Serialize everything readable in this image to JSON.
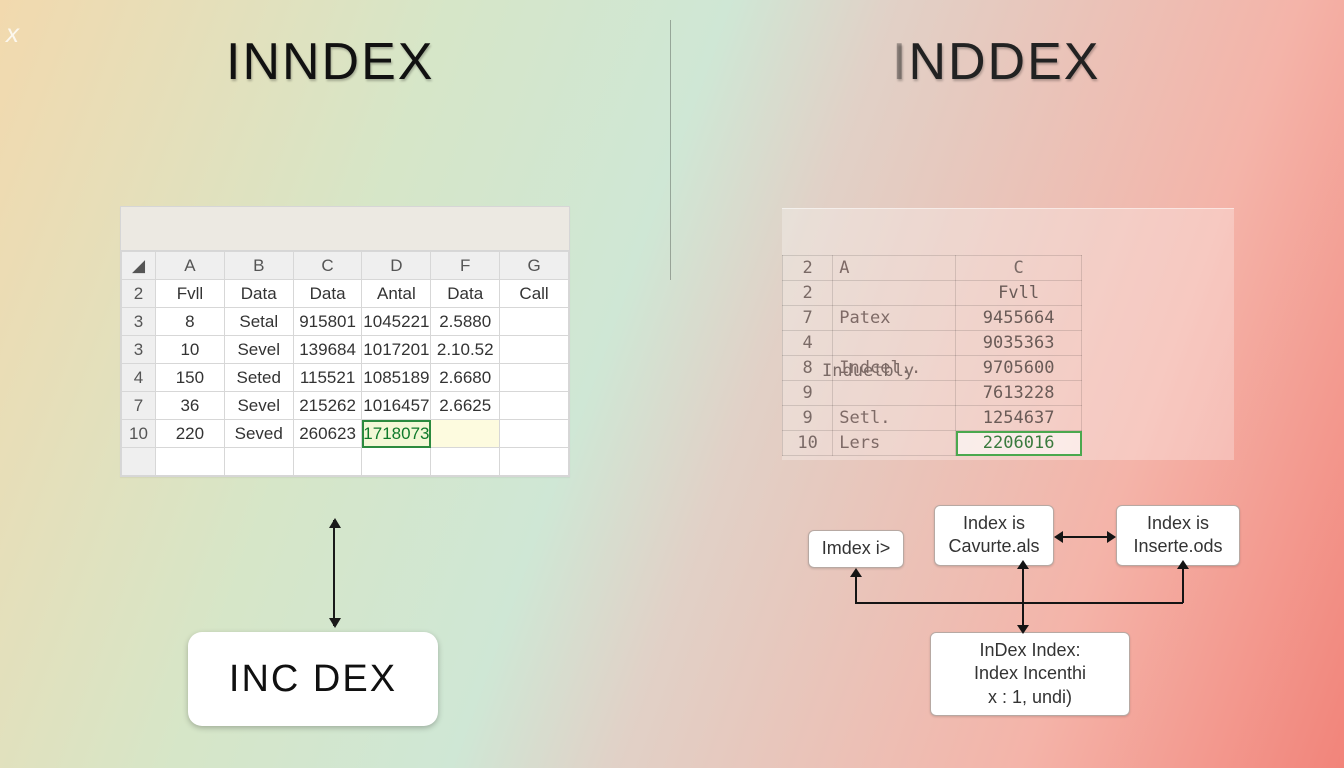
{
  "titles": {
    "left": "INNDEX",
    "right_fade": "I",
    "right_rest": "NDDEX"
  },
  "left_sheet": {
    "cols": [
      "",
      "A",
      "B",
      "C",
      "D",
      "F",
      "G"
    ],
    "rows": [
      {
        "h": "2",
        "cells": [
          "Fvll",
          "Data",
          "Data",
          "Antal",
          "Data",
          "Call"
        ]
      },
      {
        "h": "3",
        "cells": [
          "8",
          "Setal",
          "915801",
          "1045221",
          "2.5880",
          ""
        ]
      },
      {
        "h": "3",
        "cells": [
          "10",
          "Sevel",
          "139684",
          "1017201",
          "2.10.52",
          ""
        ]
      },
      {
        "h": "4",
        "cells": [
          "150",
          "Seted",
          "115521",
          "1085189",
          "2.6680",
          ""
        ]
      },
      {
        "h": "7",
        "cells": [
          "36",
          "Sevel",
          "215262",
          "1016457",
          "2.6625",
          ""
        ]
      },
      {
        "h": "10",
        "cells": [
          "220",
          "Seved",
          "260623",
          "1718073",
          "",
          ""
        ]
      }
    ],
    "selected": {
      "row": 5,
      "col": 3
    }
  },
  "right_sheet": {
    "cols": [
      "",
      "A",
      "C"
    ],
    "outer_label": "Induetbly",
    "rows": [
      {
        "h": "2",
        "cells": [
          "",
          ""
        ]
      },
      {
        "h": "2",
        "cells": [
          "",
          "Fvll"
        ]
      },
      {
        "h": "7",
        "cells": [
          "Patex",
          "9455664"
        ]
      },
      {
        "h": "4",
        "cells": [
          "",
          "9035363"
        ]
      },
      {
        "h": "8",
        "cells": [
          "Indcel..",
          "9705600"
        ]
      },
      {
        "h": "9",
        "cells": [
          "",
          "7613228"
        ]
      },
      {
        "h": "9",
        "cells": [
          "Setl.",
          "1254637"
        ]
      },
      {
        "h": "10",
        "cells": [
          "Lers",
          "2206016"
        ]
      }
    ],
    "selected_row": 7
  },
  "bottom_left_box": "INC DEX",
  "diagram": {
    "n1": "Imdex i>",
    "n2a": "Index is",
    "n2b": "Cavurte.als",
    "n3a": "Index is",
    "n3b": "Inserte.ods",
    "n4a": "InDex Index:",
    "n4b": "Index Incenthi",
    "n4c": "x : 1, undi)"
  }
}
